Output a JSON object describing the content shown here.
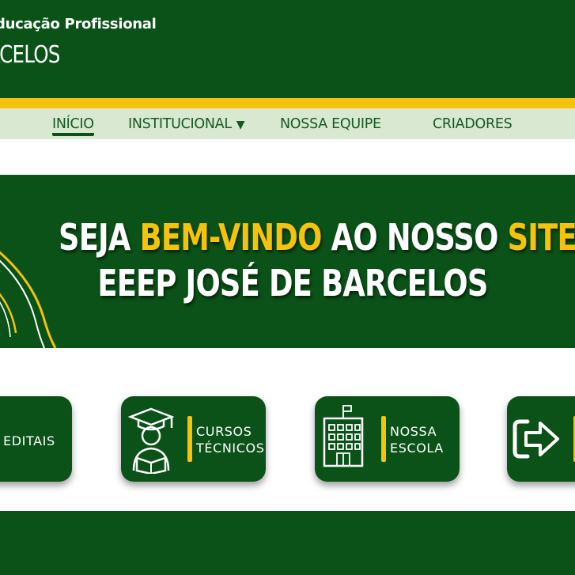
{
  "header": {
    "line1": "Educação Profissional",
    "line2": "BARCELOS"
  },
  "nav": {
    "items": [
      {
        "label": "INÍCIO"
      },
      {
        "label": "INSTITUCIONAL",
        "caret": "▼"
      },
      {
        "label": "NOSSA EQUIPE"
      },
      {
        "label": "CRIADORES"
      }
    ]
  },
  "banner": {
    "line1_part1": "SEJA ",
    "line1_highlight1": "BEM-VINDO",
    "line1_part2": " AO NOSSO ",
    "line1_highlight2": "SITE",
    "line1_part3": "!",
    "line2": "EEEP JOSÉ DE BARCELOS"
  },
  "cards": [
    {
      "line1": "EDITAIS",
      "line2": ""
    },
    {
      "line1": "CURSOS",
      "line2": "TÉCNICOS",
      "icon": "graduate-reading-icon"
    },
    {
      "line1": "NOSSA",
      "line2": "ESCOLA",
      "icon": "school-building-icon"
    },
    {
      "line1": "",
      "line2": "",
      "icon": "login-arrow-icon"
    }
  ],
  "colors": {
    "primary_green": "#0a5218",
    "accent_yellow": "#f5c20d",
    "nav_background": "#d9e8d0"
  }
}
